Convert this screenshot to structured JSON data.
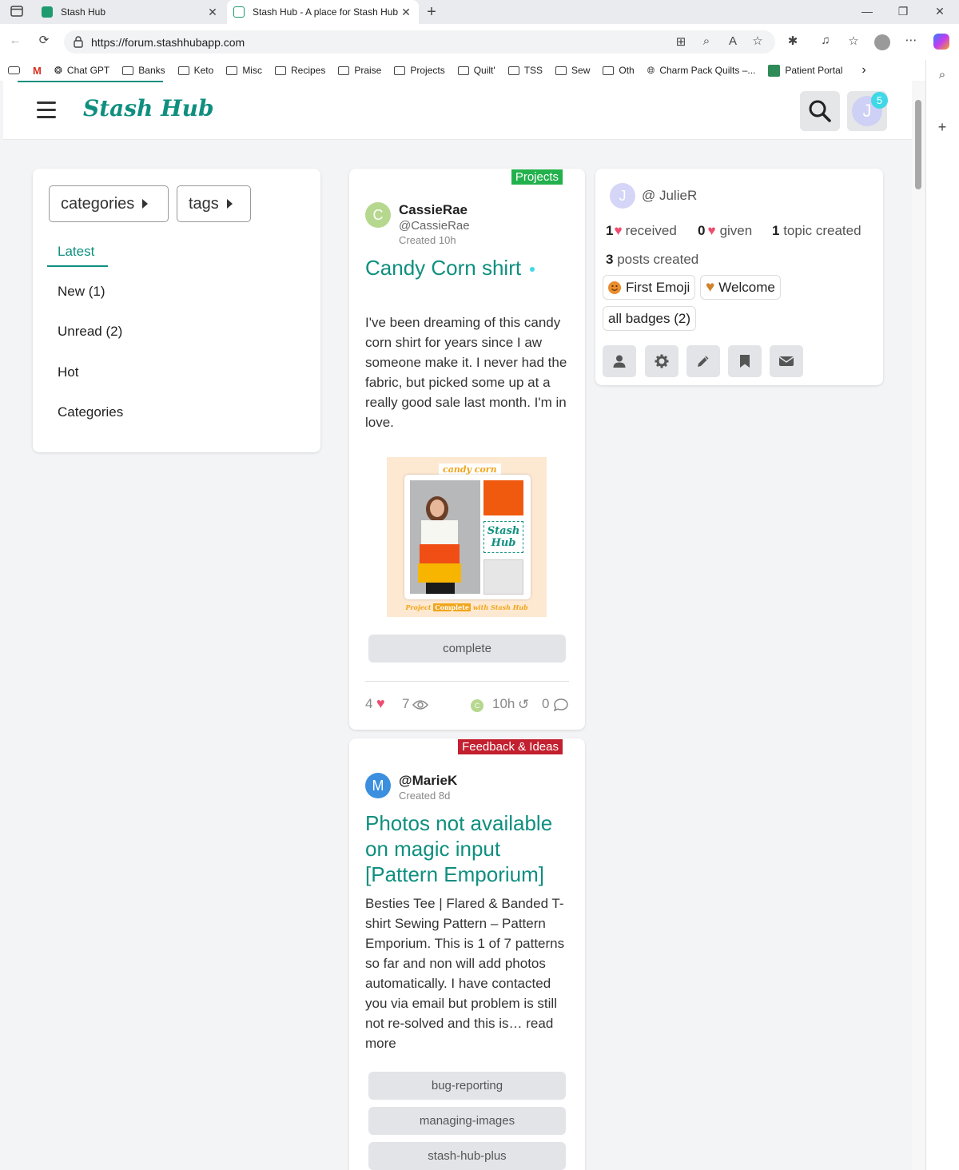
{
  "browser": {
    "tabs": [
      {
        "title": "Stash Hub",
        "active": false
      },
      {
        "title": "Stash Hub - A place for Stash Hub",
        "active": true
      }
    ],
    "new_tab_symbol": "+",
    "url": "https://forum.stashhubapp.com",
    "bookmarks": [
      "Chat GPT",
      "Banks",
      "Keto",
      "Misc",
      "Recipes",
      "Praise",
      "Projects",
      "Quilt'",
      "TSS",
      "Sew",
      "Oth",
      "Charm Pack Quilts –...",
      "Patient Portal"
    ]
  },
  "site": {
    "logo": "Stash Hub",
    "notification_count": "5",
    "user_initial": "J",
    "accent_color": "#0f8f7f"
  },
  "nav": {
    "categories_label": "categories",
    "tags_label": "tags",
    "items": [
      "Latest",
      "New (1)",
      "Unread (2)",
      "Hot",
      "Categories"
    ]
  },
  "topics": [
    {
      "category": "Projects",
      "category_color": "#22b14c",
      "author": "CassieRae",
      "handle": "@CassieRae",
      "created": "Created 10h",
      "avatar_initial": "C",
      "title": "Candy Corn shirt",
      "excerpt": "I've been dreaming of this candy corn shirt for years since I aw someone make it. I never had the fabric, but picked some up at a really good sale last month. I'm in love.",
      "image_caption_top": "candy corn",
      "image_caption_bottom_pre": "Project",
      "image_caption_bottom_tag": "Complete",
      "image_caption_bottom_post": "with Stash Hub",
      "image_logo": "Stash Hub",
      "tags": [
        "complete"
      ],
      "likes": "4",
      "views": "7",
      "last_activity": "10h",
      "replies": "0",
      "last_poster_initial": "C"
    },
    {
      "category": "Feedback & Ideas",
      "category_color": "#c2202f",
      "author": "@MarieK",
      "created": "Created 8d",
      "avatar_initial": "M",
      "title": "Photos not available on magic input [Pattern Emporium]",
      "excerpt": "Besties Tee | Flared & Banded T-shirt Sewing Pattern – Pattern Emporium. This is 1 of 7 patterns so far and non will add photos automatically. I have contacted you via email but problem is still not re-solved and this is… read more",
      "tags": [
        "bug-reporting",
        "managing-images",
        "stash-hub-plus"
      ]
    }
  ],
  "profile": {
    "initial": "J",
    "name": "@ JulieR",
    "received_count": "1",
    "received_label": "received",
    "given_count": "0",
    "given_label": "given",
    "topics_count": "1",
    "topics_label": "topic created",
    "posts_count": "3",
    "posts_label": "posts created",
    "badges": [
      "First Emoji",
      "Welcome"
    ],
    "all_badges_label": "all badges (2)"
  }
}
